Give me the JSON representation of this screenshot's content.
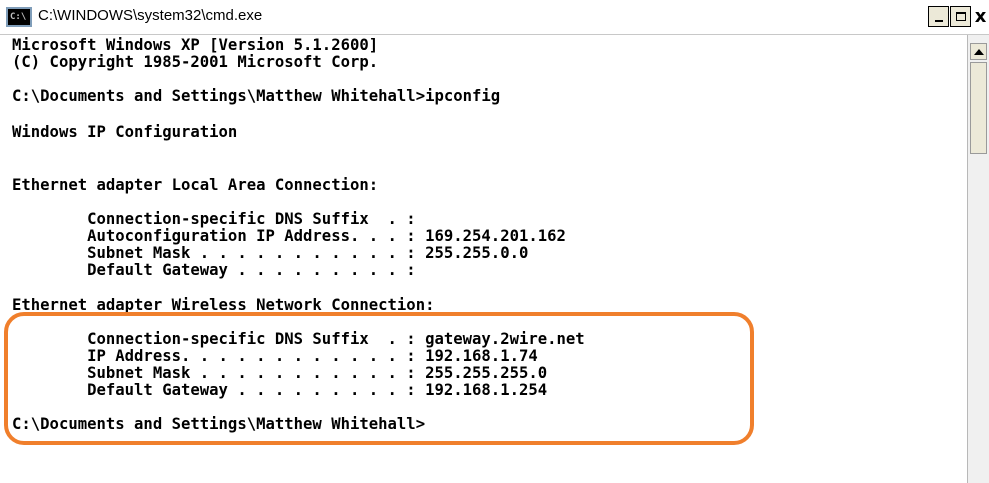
{
  "window": {
    "title": "C:\\WINDOWS\\system32\\cmd.exe",
    "icon_text": "C:\\",
    "min_label": "",
    "close_label": "x"
  },
  "console": {
    "lines": [
      "Microsoft Windows XP [Version 5.1.2600]",
      "(C) Copyright 1985-2001 Microsoft Corp.",
      "C:\\Documents and Settings\\Matthew Whitehall>ipconfig",
      "Windows IP Configuration",
      "Ethernet adapter Local Area Connection:",
      "        Connection-specific DNS Suffix  . :",
      "        Autoconfiguration IP Address. . . : 169.254.201.162",
      "        Subnet Mask . . . . . . . . . . . : 255.255.0.0",
      "        Default Gateway . . . . . . . . . :",
      "Ethernet adapter Wireless Network Connection:",
      "        Connection-specific DNS Suffix  . : gateway.2wire.net",
      "        IP Address. . . . . . . . . . . . : 192.168.1.74",
      "        Subnet Mask . . . . . . . . . . . : 255.255.255.0",
      "        Default Gateway . . . . . . . . . : 192.168.1.254",
      "C:\\Documents and Settings\\Matthew Whitehall>"
    ]
  },
  "highlight": {
    "color": "#f07f2c"
  }
}
